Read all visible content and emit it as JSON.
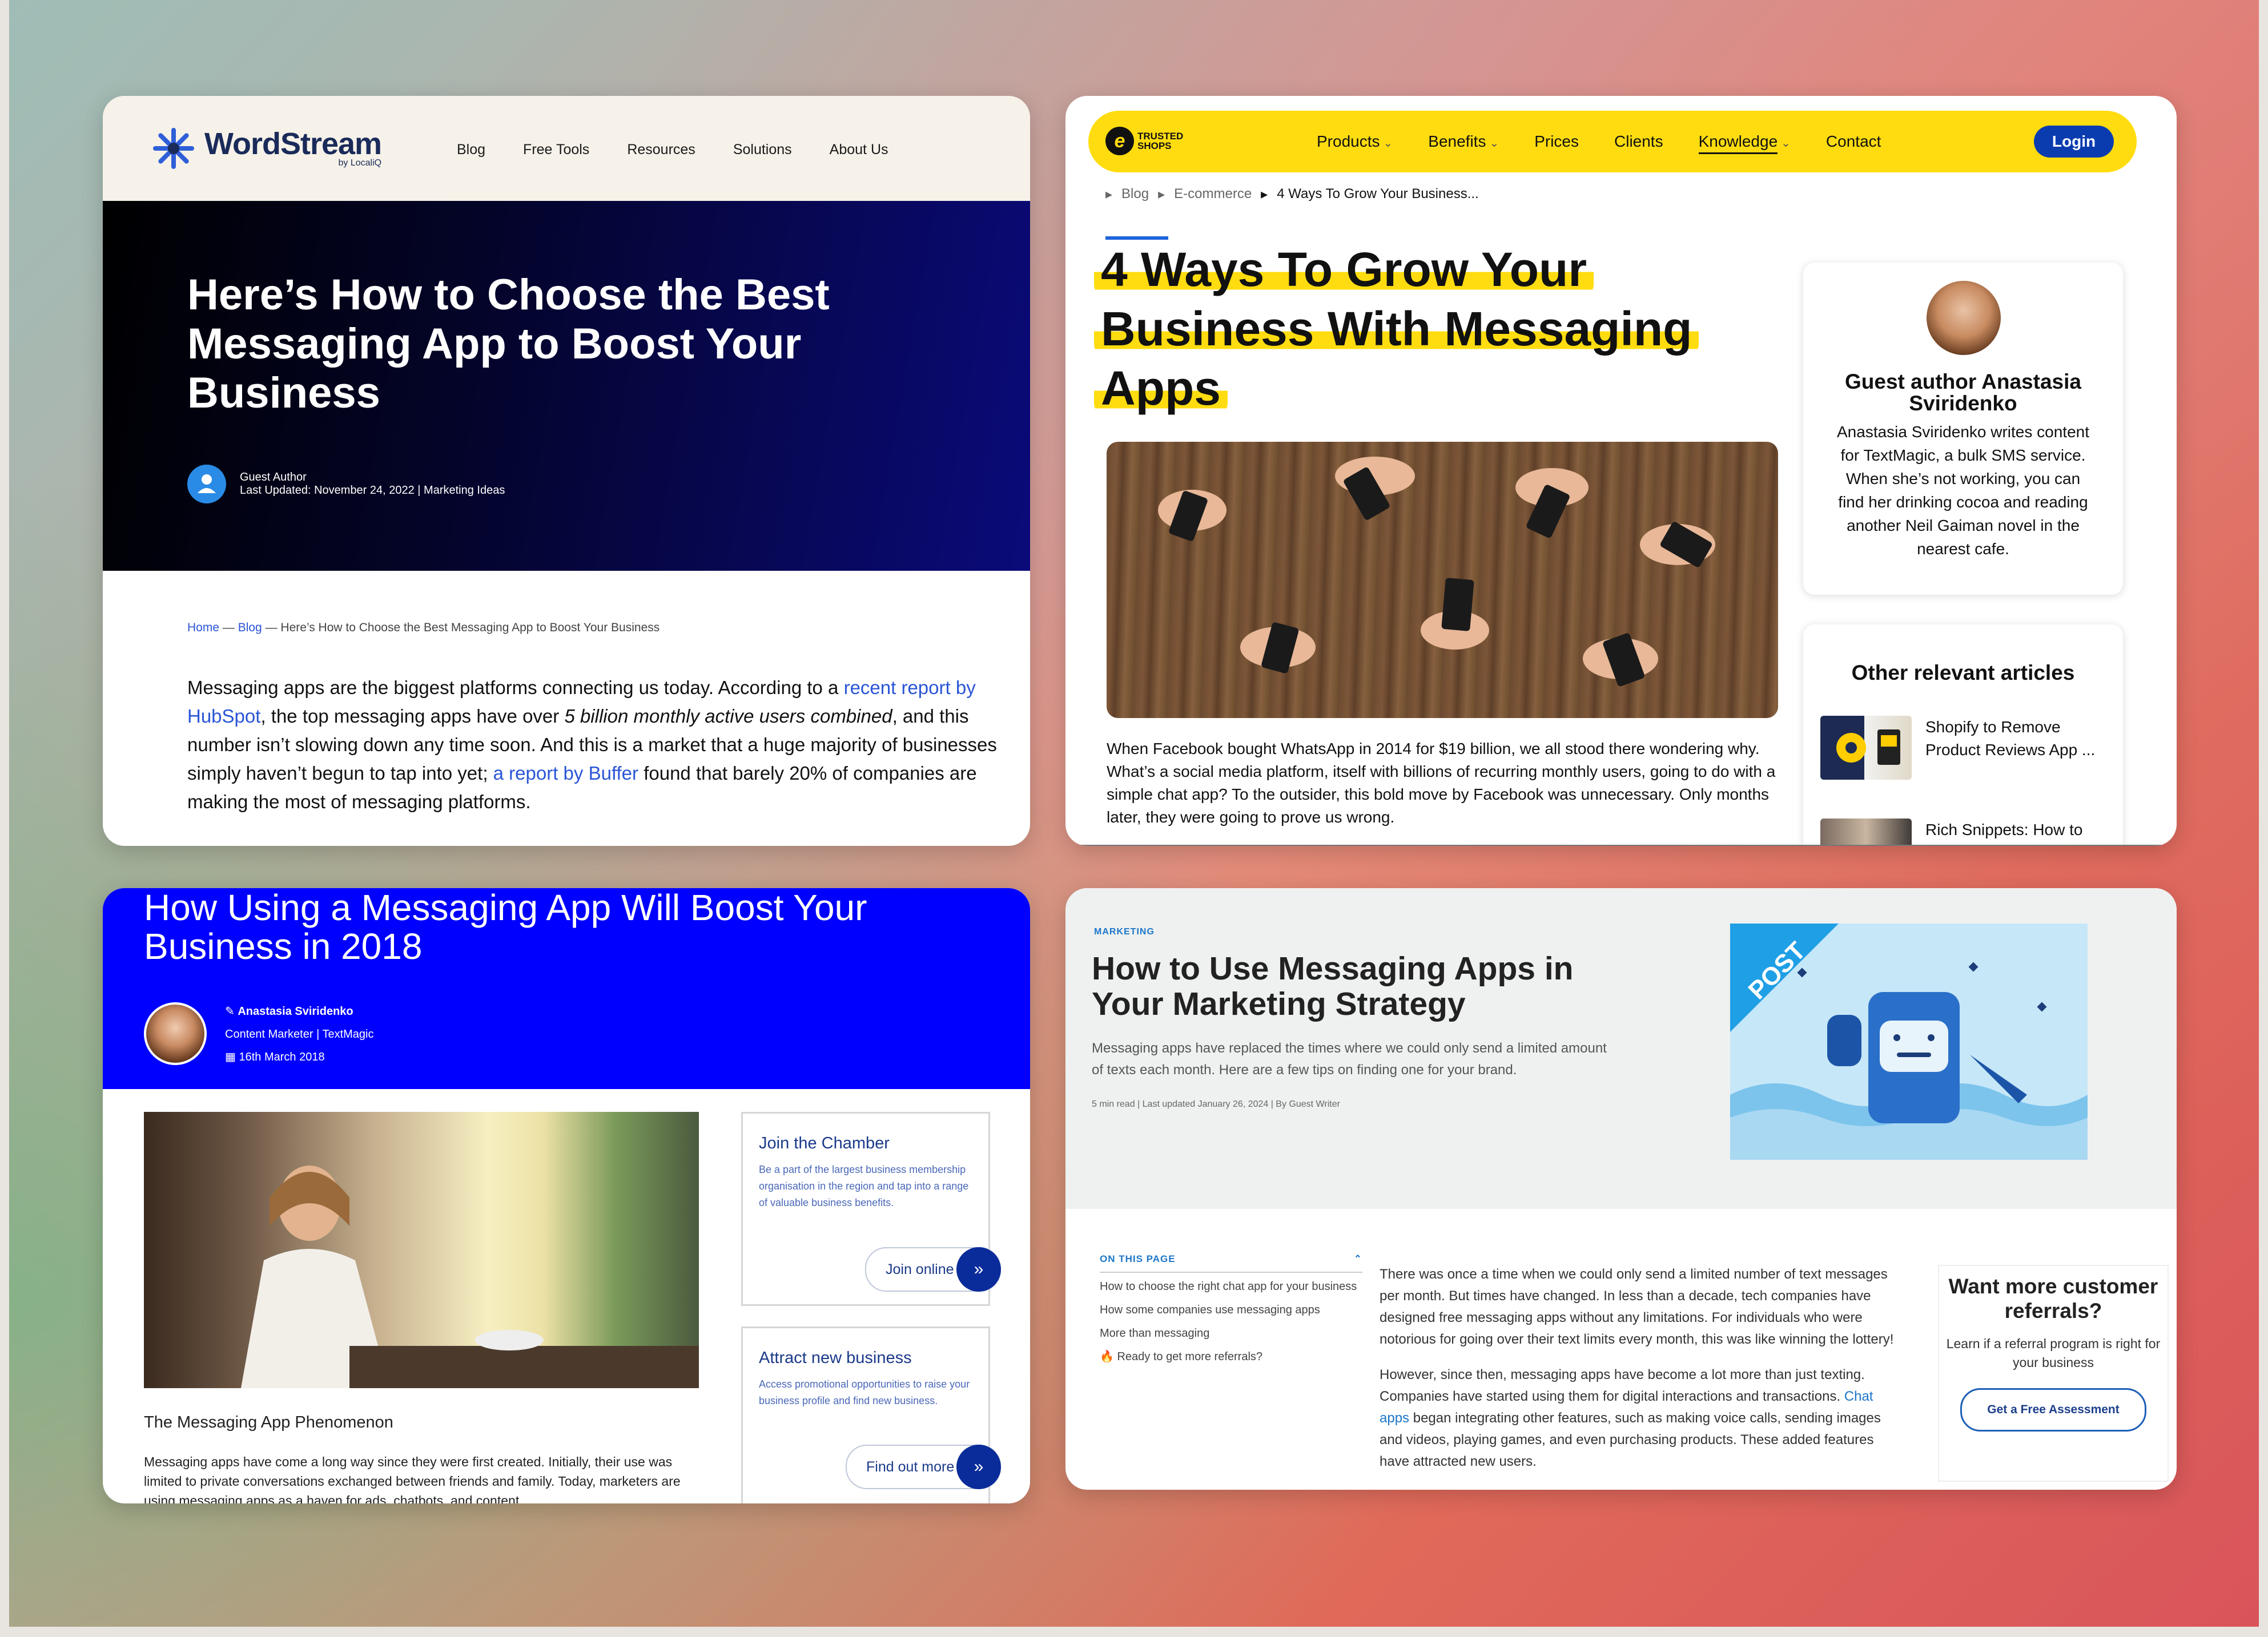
{
  "card1": {
    "logo": {
      "word": "WordStream",
      "sub": "by LocaliQ"
    },
    "nav": [
      "Blog",
      "Free Tools",
      "Resources",
      "Solutions",
      "About Us"
    ],
    "title": "Here’s How to Choose the Best Messaging App to Boost Your Business",
    "author": "Guest Author",
    "updated": "Last Updated: November 24, 2022 | Marketing Ideas",
    "breadcrumb": {
      "home": "Home",
      "blog": "Blog",
      "sep": " — ",
      "current": "Here’s How to Choose the Best Messaging App to Boost Your Business"
    },
    "body": {
      "p1": "Messaging apps are the biggest platforms connecting us today. According to a ",
      "link1": "recent report by HubSpot",
      "p2": ", the top messaging apps have over ",
      "em1": "5 billion monthly active users combined",
      "p3": ", and this number isn’t slowing down any time soon. And this is a market that a huge majority of businesses simply haven’t begun to tap into yet; ",
      "link2": "a report by Buffer",
      "p4": " found that barely 20% of companies are making the most of messaging platforms."
    }
  },
  "card2": {
    "logo": {
      "mark": "e",
      "line1": "TRUSTED",
      "line2": "SHOPS"
    },
    "nav": [
      {
        "label": "Products",
        "chevron": true
      },
      {
        "label": "Benefits",
        "chevron": true
      },
      {
        "label": "Prices",
        "chevron": false
      },
      {
        "label": "Clients",
        "chevron": false
      },
      {
        "label": "Knowledge",
        "chevron": true
      },
      {
        "label": "Contact",
        "chevron": false
      }
    ],
    "login": "Login",
    "breadcrumb": [
      "Blog",
      "E-commerce",
      "4 Ways To Grow Your Business..."
    ],
    "title_lines": [
      "4 Ways To Grow Your",
      "Business With Messaging",
      "Apps"
    ],
    "paragraph": "When Facebook bought WhatsApp in 2014 for $19 billion, we all stood there wondering why. What’s a social media platform, itself with billions of recurring monthly users, going to do with a simple chat app? To the outsider, this bold move by Facebook was unnecessary. Only months later, they were going to prove us wrong.",
    "author_name": "Guest author Anastasia Sviridenko",
    "author_bio": "Anastasia Sviridenko writes content for TextMagic, a bulk SMS service. When she’s not working, you can find her drinking cocoa and reading another Neil Gaiman novel in the nearest cafe.",
    "related_title": "Other relevant articles",
    "related": [
      "Shopify to Remove Product Reviews App ...",
      "Rich Snippets: How to"
    ]
  },
  "card3": {
    "title": "How Using a Messaging App Will Boost Your Business in 2018",
    "author": "Anastasia Sviridenko",
    "role": "Content Marketer | TextMagic",
    "date": "16th March 2018",
    "image_title": "The Messaging App Phenomenon",
    "image_body": "Messaging apps have come a long way since they were first created. Initially, their use was limited to private conversations exchanged between friends and family. Today, marketers are using messaging apps as a haven for ads, chatbots, and content",
    "box1": {
      "title": "Join the Chamber",
      "desc": "Be a part of the largest business membership organisation in the region and tap into a range of valuable business benefits.",
      "button": "Join online"
    },
    "box2": {
      "title": "Attract new business",
      "desc": "Access promotional opportunities to raise your business profile and find new business.",
      "button": "Find out more"
    }
  },
  "card4": {
    "tag": "MARKETING",
    "title": "How to Use Messaging Apps in Your Marketing Strategy",
    "subtitle": "Messaging apps have replaced the times where we could only send a limited amount of texts each month. Here are a few tips on finding one for your brand.",
    "meta": "5 min read  |  Last updated January 26, 2024  |  By Guest Writer",
    "illustration_text": "POST",
    "toc_header": "ON THIS PAGE",
    "toc": [
      "How to choose the right chat app for your business",
      "How some companies use messaging apps",
      "More than messaging",
      "🔥 Ready to get more referrals?"
    ],
    "para1": "There was once a time when we could only send a limited number of text messages per month. But times have changed. In less than a decade, tech companies have designed free messaging apps without any limitations. For individuals who were notorious for going over their text limits every month, this was like winning the lottery!",
    "para2a": "However, since then, messaging apps have become a lot more than just texting. Companies have started using them for digital interactions and transactions. ",
    "para2_link": "Chat apps",
    "para2b": " began integrating other features, such as making voice calls, sending images and videos, playing games, and even purchasing products. These added features have attracted new users.",
    "cta_title": "Want more customer referrals?",
    "cta_text": "Learn if a referral program is right for your business",
    "cta_button": "Get a Free Assessment"
  },
  "colors": {
    "wordstream_navy": "#1a2b5a",
    "trustedshops_yellow": "#ffdc0f",
    "textmagic_blue": "#0000ff",
    "link_blue": "#2a55d6"
  }
}
